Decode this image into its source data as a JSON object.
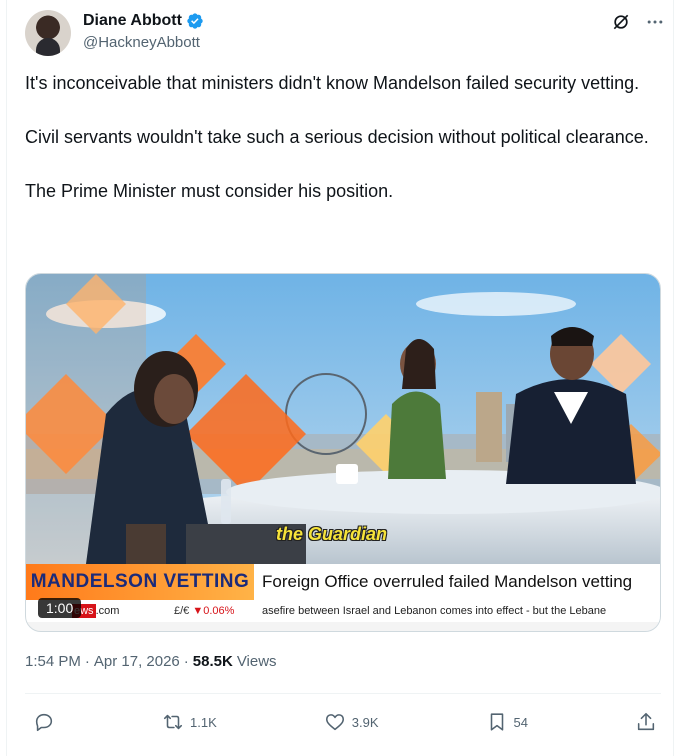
{
  "author": {
    "name": "Diane Abbott",
    "handle": "@HackneyAbbott",
    "verified_icon": "verified-badge-icon"
  },
  "tweet": {
    "paragraphs": [
      "It's inconceivable that ministers didn't know Mandelson failed security vetting.",
      "Civil servants wouldn't take such a serious decision without political clearance.",
      "The Prime Minister must consider his position."
    ]
  },
  "video": {
    "caption": "the Guardian",
    "banner_label": "MANDELSON VETTING",
    "banner_headline": "Foreign Office overruled failed Mandelson vetting",
    "ticker_site_red": "ews",
    "ticker_site_rest": ".com",
    "ticker_fx": "£/€",
    "ticker_fx_change": "▼0.06%",
    "ticker_news": "asefire between Israel and Lebanon comes into effect - but the Lebane",
    "timer": "1:00",
    "accent_orange": "#ff7a1a",
    "banner_text_color": "#1b2b7a"
  },
  "meta": {
    "time": "1:54 PM",
    "sep1": "·",
    "date": "Apr 17, 2026",
    "sep2": "·",
    "views_count": "58.5K",
    "views_label": "Views"
  },
  "actions": {
    "reply_icon": "reply-icon",
    "retweet_count": "1.1K",
    "like_count": "3.9K",
    "bookmark_count": "54",
    "share_icon": "share-icon"
  },
  "colors": {
    "text": "#0f1419",
    "secondary": "#536471",
    "verified": "#1d9bf0"
  }
}
